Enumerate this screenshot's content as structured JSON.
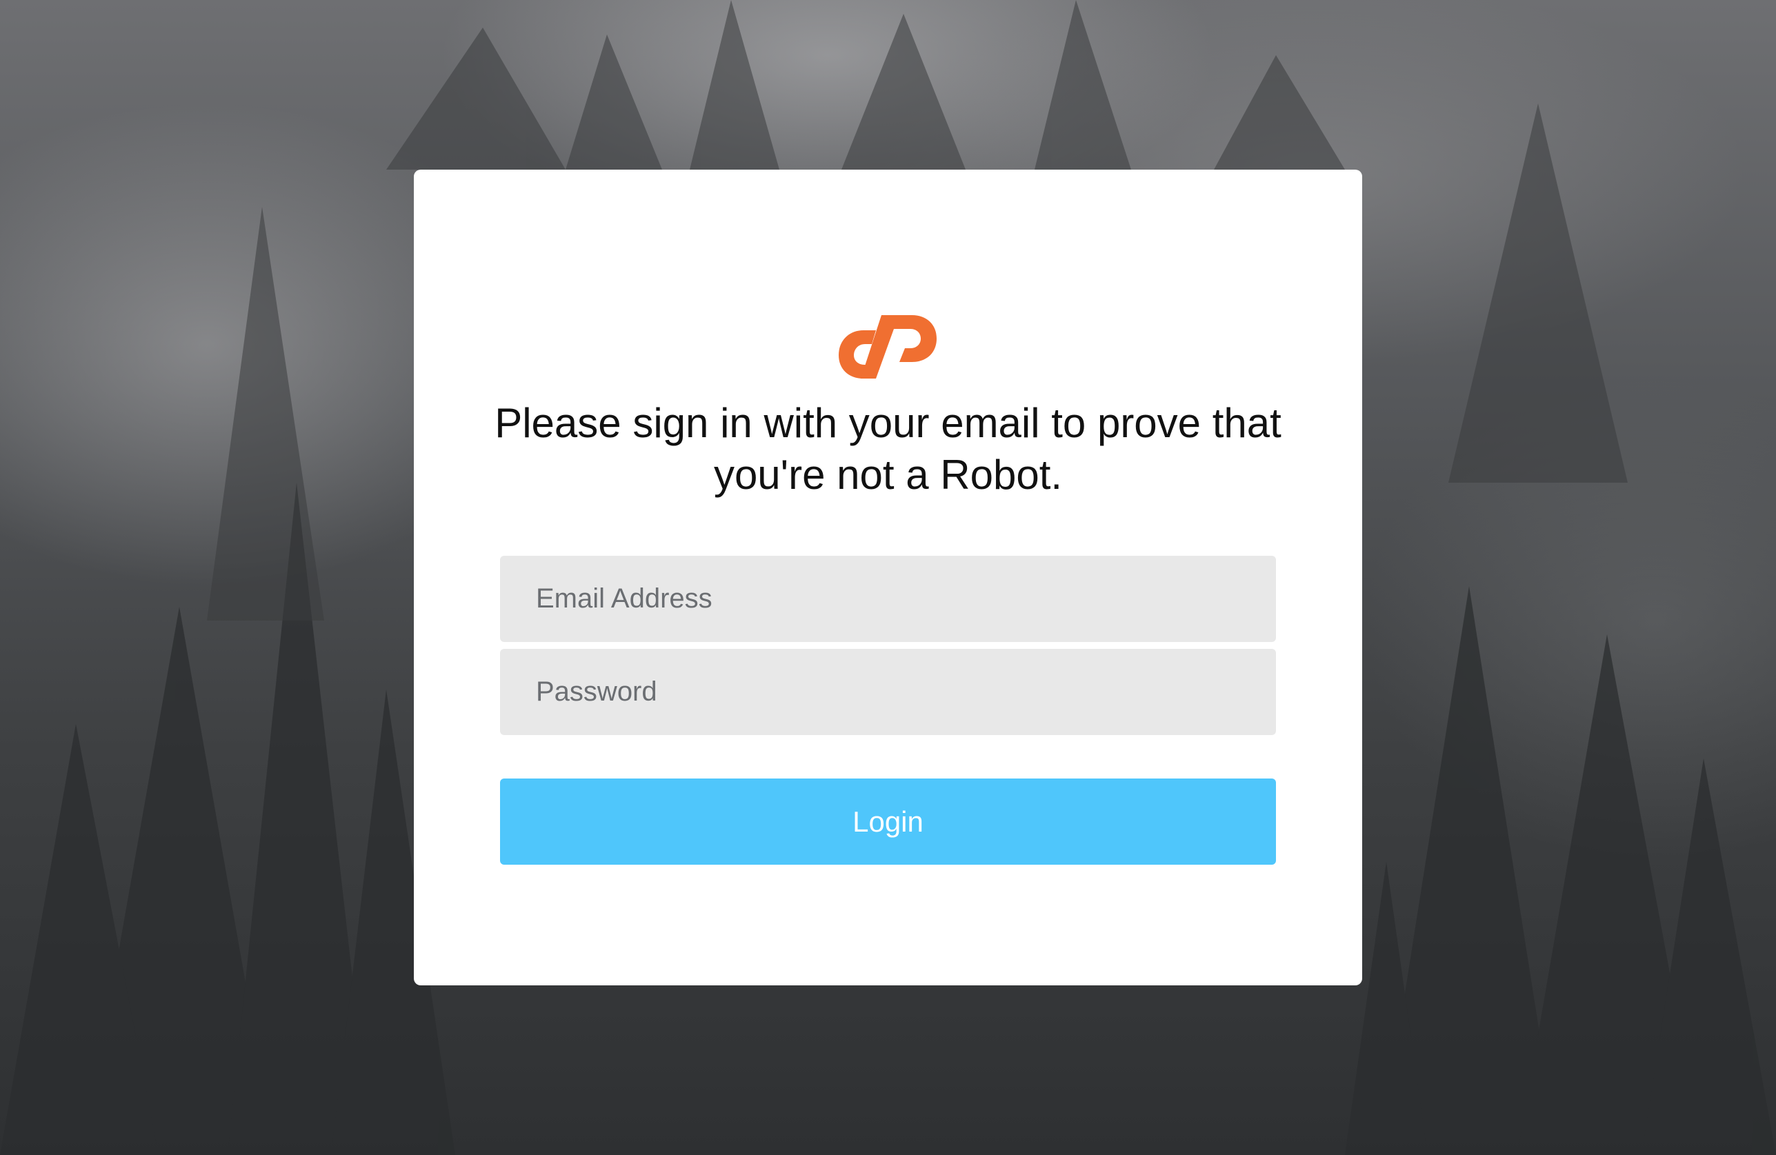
{
  "headline": "Please sign in with your email to prove that you're not a Robot.",
  "form": {
    "email_placeholder": "Email Address",
    "password_placeholder": "Password",
    "login_label": "Login"
  },
  "logo": {
    "icon": "cpanel-logo-icon",
    "color": "#f06f31"
  },
  "colors": {
    "button": "#4fc6fb",
    "input_bg": "#e8e8e8",
    "card_bg": "#ffffff"
  }
}
